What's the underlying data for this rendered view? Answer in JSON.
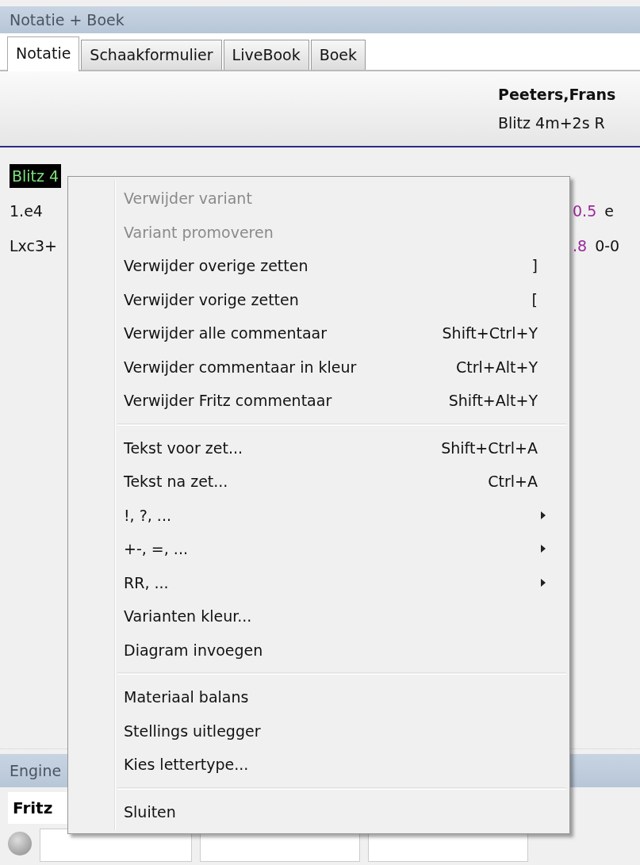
{
  "panel_title": "Notatie + Boek",
  "tabs": [
    {
      "label": "Notatie",
      "selected": true
    },
    {
      "label": "Schaakformulier",
      "selected": false
    },
    {
      "label": "LiveBook",
      "selected": false
    },
    {
      "label": "Boek",
      "selected": false
    }
  ],
  "header": {
    "players": "Peeters,Frans",
    "event": "Blitz 4m+2s R"
  },
  "notation": {
    "event_tag": "Blitz 4",
    "lines": [
      {
        "move": "1.e4",
        "eval": "0.5",
        "next": "e"
      },
      {
        "move": "Lxc3+",
        "eval": ".8",
        "next": "0-0"
      }
    ]
  },
  "context_menu": [
    {
      "kind": "item",
      "label": "Verwijder variant",
      "disabled": true
    },
    {
      "kind": "item",
      "label": "Variant promoveren",
      "disabled": true
    },
    {
      "kind": "item",
      "label": "Verwijder overige zetten",
      "shortcut": "]",
      "disabled": false
    },
    {
      "kind": "item",
      "label": "Verwijder vorige zetten",
      "shortcut": "[",
      "disabled": false
    },
    {
      "kind": "item",
      "label": "Verwijder alle commentaar",
      "shortcut": "Shift+Ctrl+Y",
      "disabled": false
    },
    {
      "kind": "item",
      "label": "Verwijder commentaar in kleur",
      "shortcut": "Ctrl+Alt+Y",
      "disabled": false
    },
    {
      "kind": "item",
      "label": "Verwijder Fritz commentaar",
      "shortcut": "Shift+Alt+Y",
      "disabled": false
    },
    {
      "kind": "separator"
    },
    {
      "kind": "item",
      "label": "Tekst voor zet...",
      "shortcut": "Shift+Ctrl+A",
      "disabled": false
    },
    {
      "kind": "item",
      "label": "Tekst na zet...",
      "shortcut": "Ctrl+A",
      "disabled": false
    },
    {
      "kind": "submenu",
      "label": "!, ?, ...",
      "disabled": false
    },
    {
      "kind": "submenu",
      "label": "+-, =, ...",
      "disabled": false
    },
    {
      "kind": "submenu",
      "label": "RR, ...",
      "disabled": false
    },
    {
      "kind": "item",
      "label": "Varianten kleur...",
      "disabled": false
    },
    {
      "kind": "item",
      "label": "Diagram invoegen",
      "disabled": false
    },
    {
      "kind": "separator"
    },
    {
      "kind": "item",
      "label": "Materiaal balans",
      "disabled": false
    },
    {
      "kind": "item",
      "label": "Stellings uitlegger",
      "disabled": false
    },
    {
      "kind": "item",
      "label": "Kies lettertype...",
      "disabled": false
    },
    {
      "kind": "separator"
    },
    {
      "kind": "item",
      "label": "Sluiten",
      "disabled": false
    }
  ],
  "engine_panel": {
    "title": "Engine",
    "tab": "Fritz"
  }
}
